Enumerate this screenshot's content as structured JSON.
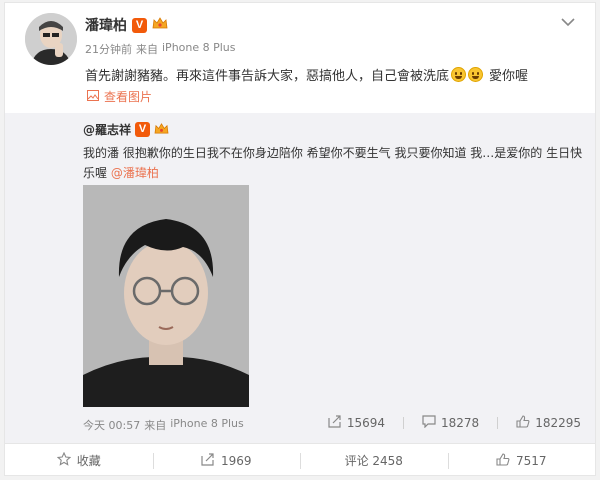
{
  "post": {
    "author": "潘瑋柏",
    "time": "21分钟前",
    "source_prefix": "来自",
    "device": "iPhone 8 Plus",
    "text_before_emoji": "首先謝謝豬豬。再來這件事告訴大家，惡搞他人，自己會被洗底",
    "text_after_emoji": "愛你喔",
    "view_images": "查看图片"
  },
  "repost": {
    "author": "@羅志祥",
    "text": "我的潘 很抱歉你的生日我不在你身边陪你 希望你不要生气 我只要你知道 我…是爱你的 生日快乐喔",
    "mention": "@潘瑋柏",
    "time": "今天 00:57",
    "source_prefix": "来自",
    "device": "iPhone 8 Plus",
    "stats": {
      "reposts": "15694",
      "comments": "18278",
      "likes": "182295"
    }
  },
  "actions": {
    "favorite": "收藏",
    "repost": "1969",
    "comment": "评论 2458",
    "like": "7517"
  },
  "colors": {
    "accent": "#eb7350",
    "verified": "#f25a0a"
  },
  "icons": [
    "chevron-down-icon",
    "verified-icon",
    "crown-icon",
    "image-icon",
    "repost-icon",
    "comment-icon",
    "like-icon",
    "star-icon"
  ]
}
